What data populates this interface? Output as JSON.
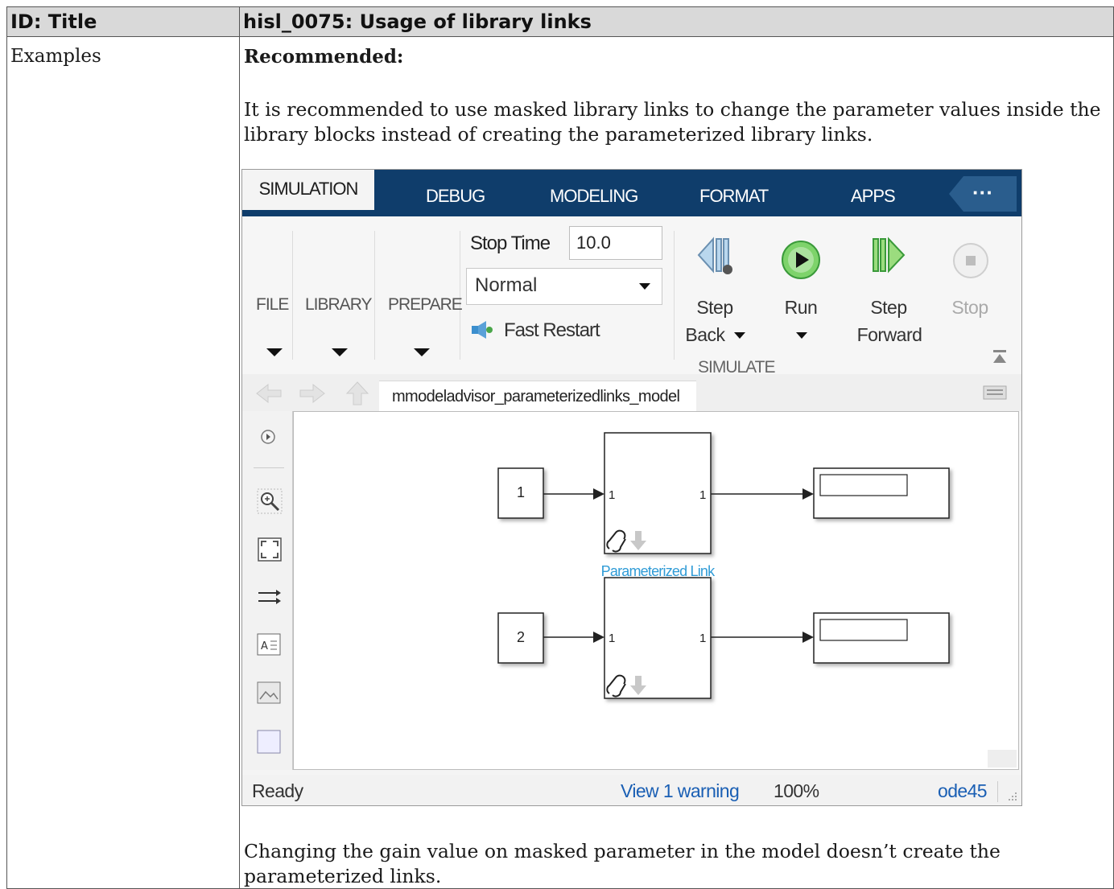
{
  "header": {
    "left": "ID: Title",
    "right": "hisl_0075: Usage of library links"
  },
  "row": {
    "label": "Examples",
    "recommended_title": "Recommended:",
    "paragraph1": "It is recommended to use masked library links to change the parameter values inside the library blocks instead of creating the parameterized library links.",
    "paragraph2": "Changing the gain value on masked parameter in the model doesn’t create the parameterized links."
  },
  "screenshot": {
    "tabs": [
      "SIMULATION",
      "DEBUG",
      "MODELING",
      "FORMAT",
      "APPS"
    ],
    "more_label": "···",
    "ribbon": {
      "file": "FILE",
      "library": "LIBRARY",
      "prepare": "PREPARE",
      "stop_time_label": "Stop Time",
      "stop_time_value": "10.0",
      "mode_value": "Normal",
      "fast_restart": "Fast Restart",
      "step_back_1": "Step",
      "step_back_2": "Back",
      "run": "Run",
      "step_forward_1": "Step",
      "step_forward_2": "Forward",
      "stop": "Stop",
      "group_label": "SIMULATE"
    },
    "breadcrumb": "mmodeladvisor_parameterizedlinks_model",
    "diagram": {
      "const1": "1",
      "const2": "2",
      "port_in": "1",
      "port_out": "1",
      "link_label": "Parameterized Link"
    },
    "status": {
      "ready": "Ready",
      "warning": "View 1 warning",
      "zoom": "100%",
      "solver": "ode45"
    },
    "colors": {
      "tab_bar": "#0f3d6b",
      "run_green": "#3cb043",
      "link_blue": "#2f9bd6",
      "status_link": "#1a5fb4"
    }
  }
}
